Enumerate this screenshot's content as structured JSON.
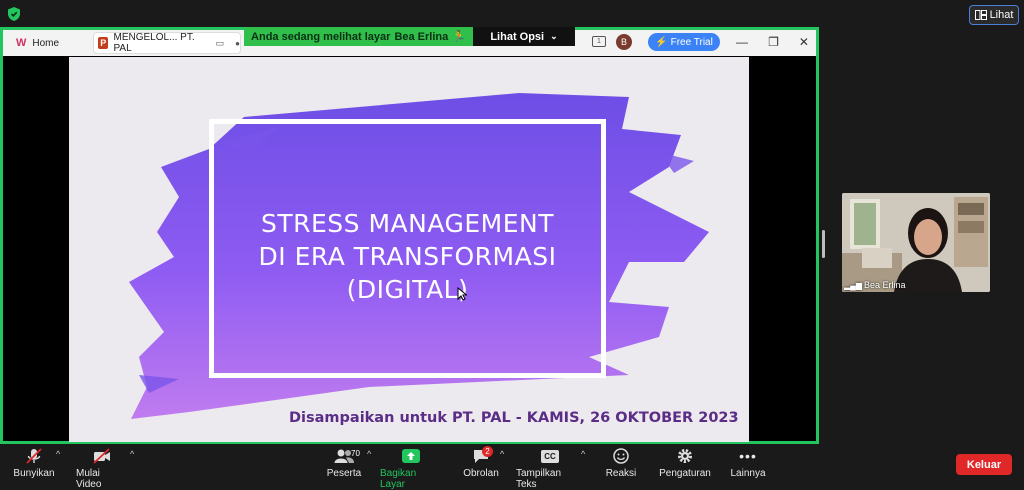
{
  "topbar": {
    "view_button_label": "Lihat"
  },
  "share_banner": {
    "viewing_text": "Anda sedang melihat layar",
    "presenter_name": "Bea Erlina",
    "options_label": "Lihat Opsi"
  },
  "shared_window": {
    "tabs": [
      {
        "label": "Home"
      },
      {
        "label": "MENGELOL... PT. PAL"
      }
    ],
    "avatar_initial": "B",
    "free_trial_label": "Free Trial"
  },
  "slide": {
    "title_lines": [
      "STRESS MANAGEMENT",
      "DI ERA TRANSFORMASI",
      "(DIGITAL)"
    ],
    "subtitle": "Disampaikan untuk PT. PAL - KAMIS, 26 OKTOBER 2023"
  },
  "participant": {
    "name": "Bea Erlina"
  },
  "toolbar": {
    "unmute_label": "Bunyikan",
    "start_video_label": "Mulai Video",
    "participants_label": "Peserta",
    "participants_count": "70",
    "share_label": "Bagikan Layar",
    "chat_label": "Obrolan",
    "chat_badge": "2",
    "captions_label": "Tampilkan Teks",
    "captions_icon_text": "CC",
    "reactions_label": "Reaksi",
    "settings_label": "Pengaturan",
    "more_label": "Lainnya",
    "leave_label": "Keluar"
  },
  "colors": {
    "share_border": "#22c55e",
    "banner_green": "#2fbf4a",
    "leave_red": "#e02828",
    "slide_purple": "#8b5cf6",
    "subtitle_purple": "#5b2d86",
    "free_trial_blue": "#3b82f6"
  }
}
